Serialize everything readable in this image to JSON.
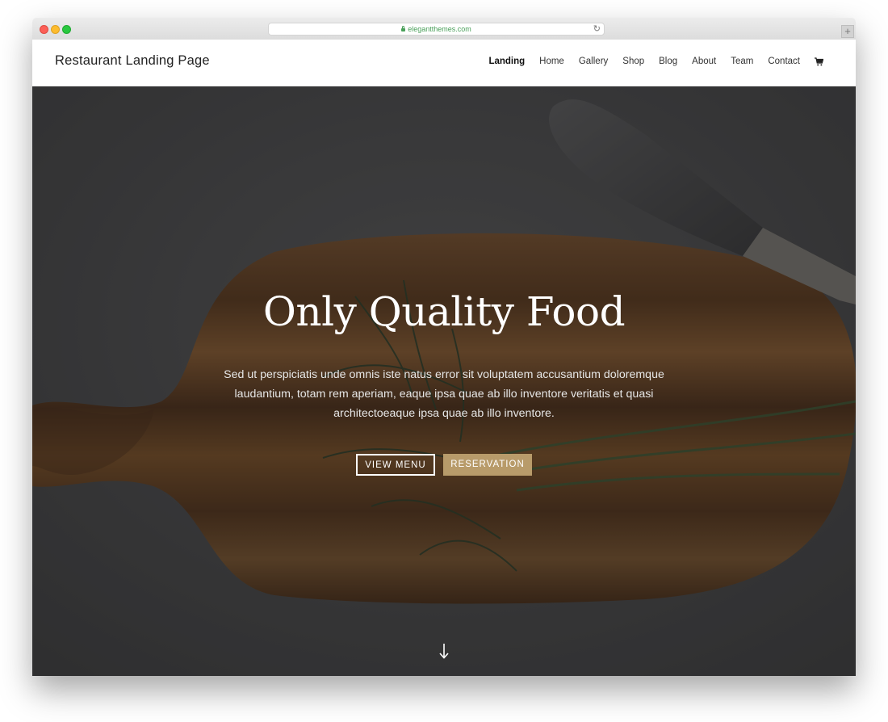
{
  "browser": {
    "url": "elegantthemes.com"
  },
  "site": {
    "title": "Restaurant Landing Page"
  },
  "nav": {
    "items": [
      "Landing",
      "Home",
      "Gallery",
      "Shop",
      "Blog",
      "About",
      "Team",
      "Contact"
    ],
    "active": "Landing"
  },
  "hero": {
    "title": "Only Quality Food",
    "text": "Sed ut perspiciatis unde omnis iste natus error sit voluptatem accusantium doloremque laudantium, totam rem aperiam, eaque ipsa quae ab illo inventore veritatis et quasi architectoeaque ipsa quae ab illo inventore.",
    "button_menu": "VIEW MENU",
    "button_reservation": "RESERVATION"
  },
  "colors": {
    "accent": "#b89b6a",
    "url_text": "#4aa05a"
  },
  "icons": {
    "cart": "shopping-cart-icon",
    "scroll": "arrow-down-icon",
    "lock": "lock-icon",
    "reload": "reload-icon"
  }
}
